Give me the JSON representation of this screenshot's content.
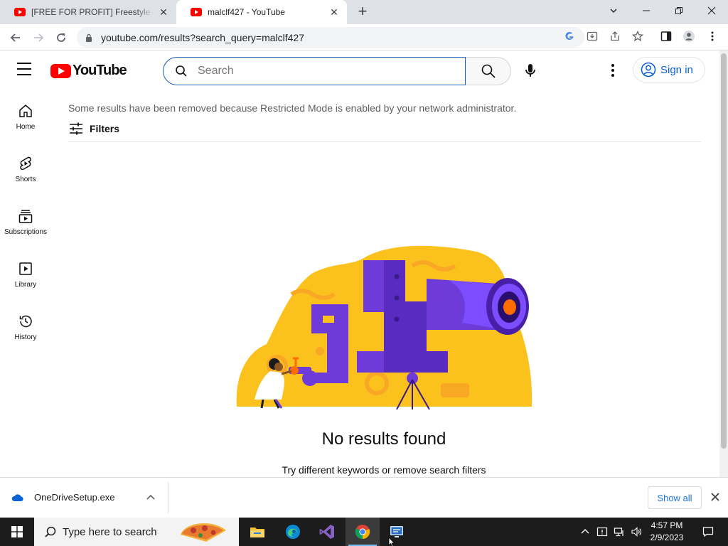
{
  "browser": {
    "tabs": [
      {
        "label": "[FREE FOR PROFIT] Freestyle Beat",
        "active": false
      },
      {
        "label": "malclf427 - YouTube",
        "active": true
      }
    ],
    "url": "youtube.com/results?search_query=malclf427"
  },
  "youtube": {
    "logo_text": "YouTube",
    "search": {
      "placeholder": "Search",
      "value": ""
    },
    "sign_in_label": "Sign in",
    "guide": [
      {
        "label": "Home",
        "icon": "home-icon"
      },
      {
        "label": "Shorts",
        "icon": "shorts-icon"
      },
      {
        "label": "Subscriptions",
        "icon": "subscriptions-icon"
      },
      {
        "label": "Library",
        "icon": "library-icon"
      },
      {
        "label": "History",
        "icon": "history-icon"
      }
    ],
    "restricted_notice": "Some results have been removed because Restricted Mode is enabled by your network administrator.",
    "filters_label": "Filters",
    "empty_state": {
      "title": "No results found",
      "subtitle": "Try different keywords or remove search filters"
    }
  },
  "download_shelf": {
    "file_name": "OneDriveSetup.exe",
    "show_all_label": "Show all"
  },
  "taskbar": {
    "search_placeholder": "Type here to search",
    "time": "4:57 PM",
    "date": "2/9/2023"
  },
  "colors": {
    "youtube_red": "#ff0000",
    "link_blue": "#065fd4",
    "illustration_yellow": "#fbc11d",
    "illustration_purple": "#6e3bd8",
    "taskbar_bg": "#1c1c1c"
  }
}
